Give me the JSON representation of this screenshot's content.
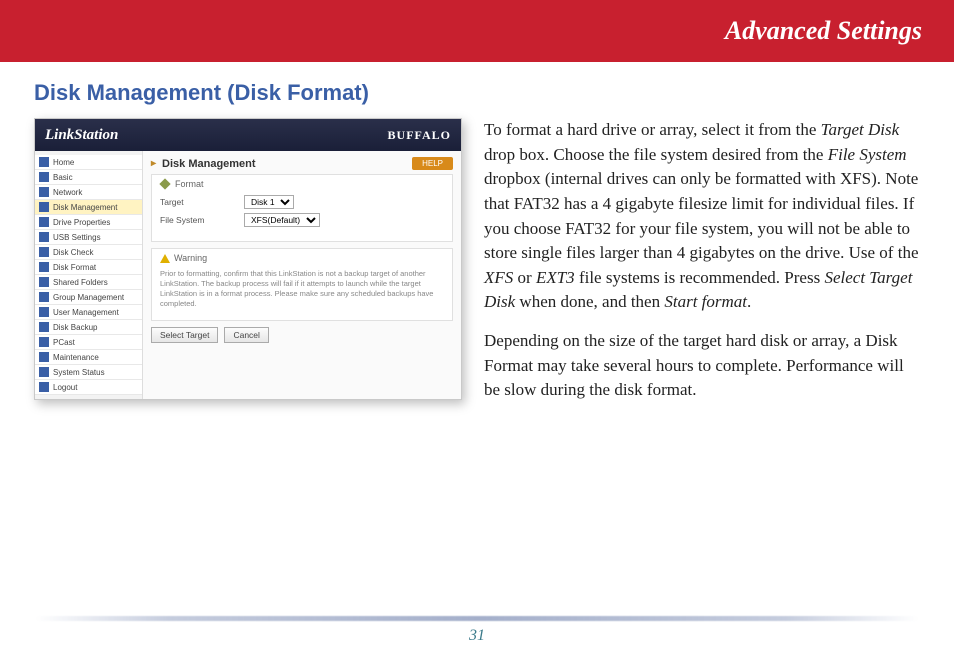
{
  "banner": {
    "title": "Advanced Settings"
  },
  "section": {
    "title": "Disk Management (Disk Format)"
  },
  "screenshot": {
    "brand": "LinkStation",
    "brand2": "BUFFALO",
    "sidebar": {
      "items": [
        {
          "label": "Home"
        },
        {
          "label": "Basic"
        },
        {
          "label": "Network"
        },
        {
          "label": "Disk Management",
          "active": true
        },
        {
          "label": "Drive Properties"
        },
        {
          "label": "USB Settings"
        },
        {
          "label": "Disk Check"
        },
        {
          "label": "Disk Format"
        },
        {
          "label": "Shared Folders"
        },
        {
          "label": "Group Management"
        },
        {
          "label": "User Management"
        },
        {
          "label": "Disk Backup"
        },
        {
          "label": "PCast"
        },
        {
          "label": "Maintenance"
        },
        {
          "label": "System Status"
        },
        {
          "label": "Logout"
        }
      ]
    },
    "pane": {
      "title": "Disk Management",
      "help": "HELP",
      "format_legend": "Format",
      "target_label": "Target",
      "target_value": "Disk 1",
      "fs_label": "File System",
      "fs_value": "XFS(Default)",
      "warning_legend": "Warning",
      "warning_text": "Prior to formatting, confirm that this LinkStation is not a backup target of another LinkStation. The backup process will fail if it attempts to launch while the target LinkStation is in a format process. Please make sure any scheduled backups have completed.",
      "btn_select": "Select Target",
      "btn_cancel": "Cancel"
    }
  },
  "body": {
    "p1_a": "To format a hard drive or array, select it from the ",
    "p1_i1": "Target Disk",
    "p1_b": " drop box.  Choose the file system desired from the ",
    "p1_i2": "File System",
    "p1_c": " dropbox (internal drives can only be formatted with XFS).  Note that FAT32 has a 4 gigabyte filesize limit for individual files.  If you choose FAT32 for your file system, you will not be able to store single files larger than 4 gigabytes on the drive.  Use of the ",
    "p1_i3": "XFS",
    "p1_d": " or ",
    "p1_i4": "EXT3",
    "p1_e": " file systems is recommended.  Press ",
    "p1_i5": "Select Target Disk",
    "p1_f": " when done, and then ",
    "p1_i6": "Start format",
    "p1_g": ".",
    "p2": "Depending on the size of the target hard disk or array, a Disk Format may take several hours to complete.  Performance will be slow during the disk format."
  },
  "footer": {
    "page": "31"
  }
}
